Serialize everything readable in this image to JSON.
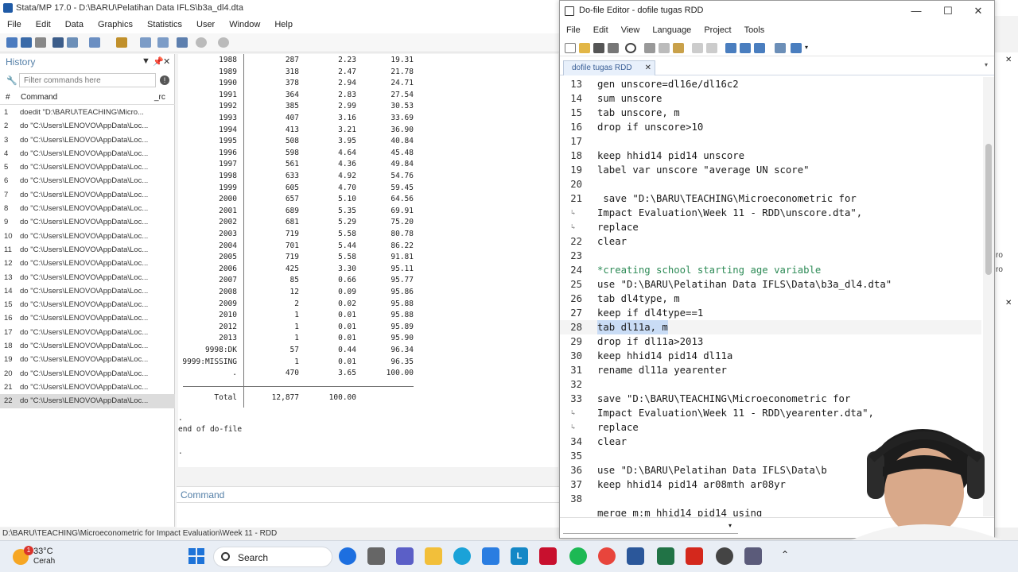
{
  "stata": {
    "title": "Stata/MP 17.0 - D:\\BARU\\Pelatihan Data IFLS\\b3a_dl4.dta",
    "menu": [
      "File",
      "Edit",
      "Data",
      "Graphics",
      "Statistics",
      "User",
      "Window",
      "Help"
    ],
    "history": {
      "title": "History",
      "filter_placeholder": "Filter commands here",
      "col_num": "#",
      "col_cmd": "Command",
      "col_rc": "_rc",
      "items": [
        {
          "n": "1",
          "cmd": "doedit \"D:\\BARU\\TEACHING\\Micro..."
        },
        {
          "n": "2",
          "cmd": "do \"C:\\Users\\LENOVO\\AppData\\Loc..."
        },
        {
          "n": "3",
          "cmd": "do \"C:\\Users\\LENOVO\\AppData\\Loc..."
        },
        {
          "n": "4",
          "cmd": "do \"C:\\Users\\LENOVO\\AppData\\Loc..."
        },
        {
          "n": "5",
          "cmd": "do \"C:\\Users\\LENOVO\\AppData\\Loc..."
        },
        {
          "n": "6",
          "cmd": "do \"C:\\Users\\LENOVO\\AppData\\Loc..."
        },
        {
          "n": "7",
          "cmd": "do \"C:\\Users\\LENOVO\\AppData\\Loc..."
        },
        {
          "n": "8",
          "cmd": "do \"C:\\Users\\LENOVO\\AppData\\Loc..."
        },
        {
          "n": "9",
          "cmd": "do \"C:\\Users\\LENOVO\\AppData\\Loc..."
        },
        {
          "n": "10",
          "cmd": "do \"C:\\Users\\LENOVO\\AppData\\Loc..."
        },
        {
          "n": "11",
          "cmd": "do \"C:\\Users\\LENOVO\\AppData\\Loc..."
        },
        {
          "n": "12",
          "cmd": "do \"C:\\Users\\LENOVO\\AppData\\Loc..."
        },
        {
          "n": "13",
          "cmd": "do \"C:\\Users\\LENOVO\\AppData\\Loc..."
        },
        {
          "n": "14",
          "cmd": "do \"C:\\Users\\LENOVO\\AppData\\Loc..."
        },
        {
          "n": "15",
          "cmd": "do \"C:\\Users\\LENOVO\\AppData\\Loc..."
        },
        {
          "n": "16",
          "cmd": "do \"C:\\Users\\LENOVO\\AppData\\Loc..."
        },
        {
          "n": "17",
          "cmd": "do \"C:\\Users\\LENOVO\\AppData\\Loc..."
        },
        {
          "n": "18",
          "cmd": "do \"C:\\Users\\LENOVO\\AppData\\Loc..."
        },
        {
          "n": "19",
          "cmd": "do \"C:\\Users\\LENOVO\\AppData\\Loc..."
        },
        {
          "n": "20",
          "cmd": "do \"C:\\Users\\LENOVO\\AppData\\Loc..."
        },
        {
          "n": "21",
          "cmd": "do \"C:\\Users\\LENOVO\\AppData\\Loc..."
        },
        {
          "n": "22",
          "cmd": "do \"C:\\Users\\LENOVO\\AppData\\Loc..."
        }
      ]
    },
    "results": {
      "rows": [
        [
          "1988",
          "287",
          "2.23",
          "19.31"
        ],
        [
          "1989",
          "318",
          "2.47",
          "21.78"
        ],
        [
          "1990",
          "378",
          "2.94",
          "24.71"
        ],
        [
          "1991",
          "364",
          "2.83",
          "27.54"
        ],
        [
          "1992",
          "385",
          "2.99",
          "30.53"
        ],
        [
          "1993",
          "407",
          "3.16",
          "33.69"
        ],
        [
          "1994",
          "413",
          "3.21",
          "36.90"
        ],
        [
          "1995",
          "508",
          "3.95",
          "40.84"
        ],
        [
          "1996",
          "598",
          "4.64",
          "45.48"
        ],
        [
          "1997",
          "561",
          "4.36",
          "49.84"
        ],
        [
          "1998",
          "633",
          "4.92",
          "54.76"
        ],
        [
          "1999",
          "605",
          "4.70",
          "59.45"
        ],
        [
          "2000",
          "657",
          "5.10",
          "64.56"
        ],
        [
          "2001",
          "689",
          "5.35",
          "69.91"
        ],
        [
          "2002",
          "681",
          "5.29",
          "75.20"
        ],
        [
          "2003",
          "719",
          "5.58",
          "80.78"
        ],
        [
          "2004",
          "701",
          "5.44",
          "86.22"
        ],
        [
          "2005",
          "719",
          "5.58",
          "91.81"
        ],
        [
          "2006",
          "425",
          "3.30",
          "95.11"
        ],
        [
          "2007",
          "85",
          "0.66",
          "95.77"
        ],
        [
          "2008",
          "12",
          "0.09",
          "95.86"
        ],
        [
          "2009",
          "2",
          "0.02",
          "95.88"
        ],
        [
          "2010",
          "1",
          "0.01",
          "95.88"
        ],
        [
          "2012",
          "1",
          "0.01",
          "95.89"
        ],
        [
          "2013",
          "1",
          "0.01",
          "95.90"
        ],
        [
          "9998:DK",
          "57",
          "0.44",
          "96.34"
        ],
        [
          "9999:MISSING",
          "1",
          "0.01",
          "96.35"
        ],
        [
          ".",
          "470",
          "3.65",
          "100.00"
        ]
      ],
      "total": [
        "Total",
        "12,877",
        "100.00"
      ],
      "footer": [
        ".",
        "end of do-file",
        "",
        "."
      ]
    },
    "command_label": "Command",
    "status_path": "D:\\BARU\\TEACHING\\Microeconometric for Impact Evaluation\\Week 11 - RDD"
  },
  "editor": {
    "title": "Do-file Editor - dofile tugas RDD",
    "controls": {
      "minimize": "—",
      "maximize": "☐",
      "close": "✕"
    },
    "menu": [
      "File",
      "Edit",
      "View",
      "Language",
      "Project",
      "Tools"
    ],
    "tab_label": "dofile tugas RDD",
    "tab_close": "✕",
    "lines": [
      {
        "num": "13",
        "text": "gen unscore=dl16e/dl16c2"
      },
      {
        "num": "14",
        "text": "sum unscore"
      },
      {
        "num": "15",
        "text": "tab unscore, m"
      },
      {
        "num": "16",
        "text": "drop if unscore>10"
      },
      {
        "num": "17",
        "text": ""
      },
      {
        "num": "18",
        "text": "keep hhid14 pid14 unscore"
      },
      {
        "num": "19",
        "text": "label var unscore \"average UN score\""
      },
      {
        "num": "20",
        "text": ""
      },
      {
        "num": "21",
        "text": " save \"D:\\BARU\\TEACHING\\Microeconometric for"
      },
      {
        "num": "",
        "wrap": true,
        "text": "Impact Evaluation\\Week 11 - RDD\\unscore.dta\","
      },
      {
        "num": "",
        "wrap": true,
        "text": "replace"
      },
      {
        "num": "22",
        "text": "clear"
      },
      {
        "num": "23",
        "text": ""
      },
      {
        "num": "24",
        "text": "*creating school starting age variable",
        "comment": true
      },
      {
        "num": "25",
        "text": "use \"D:\\BARU\\Pelatihan Data IFLS\\Data\\b3a_dl4.dta\""
      },
      {
        "num": "26",
        "text": "tab dl4type, m"
      },
      {
        "num": "27",
        "text": "keep if dl4type==1"
      },
      {
        "num": "28",
        "text": "tab dl11a, m",
        "current": true
      },
      {
        "num": "29",
        "text": "drop if dl11a>2013"
      },
      {
        "num": "30",
        "text": "keep hhid14 pid14 dl11a"
      },
      {
        "num": "31",
        "text": "rename dl11a yearenter"
      },
      {
        "num": "32",
        "text": ""
      },
      {
        "num": "33",
        "text": "save \"D:\\BARU\\TEACHING\\Microeconometric for"
      },
      {
        "num": "",
        "wrap": true,
        "text": "Impact Evaluation\\Week 11 - RDD\\yearenter.dta\","
      },
      {
        "num": "",
        "wrap": true,
        "text": "replace"
      },
      {
        "num": "34",
        "text": "clear"
      },
      {
        "num": "35",
        "text": ""
      },
      {
        "num": "36",
        "text": "use \"D:\\BARU\\Pelatihan Data IFLS\\Data\\b"
      },
      {
        "num": "37",
        "text": "keep hhid14 pid14 ar08mth ar08yr"
      },
      {
        "num": "38",
        "text": ""
      },
      {
        "num": "",
        "text": "merge m:m hhid14 pid14 using"
      }
    ]
  },
  "right_panel_fragments": [
    "ro",
    "ro"
  ],
  "taskbar": {
    "temp": "33°C",
    "condition": "Cerah",
    "badge": "1",
    "search_label": "Search",
    "icons": [
      "start-icon",
      "search-icon",
      "browser-icon",
      "files-icon",
      "chat-icon",
      "folder-icon",
      "edge-icon",
      "store-icon",
      "app-l-icon",
      "mcafee-icon",
      "spotify-icon",
      "chrome-icon",
      "word-icon",
      "excel-icon",
      "pdf-icon",
      "settings-icon",
      "calculator-icon",
      "chevron-up-icon"
    ]
  }
}
